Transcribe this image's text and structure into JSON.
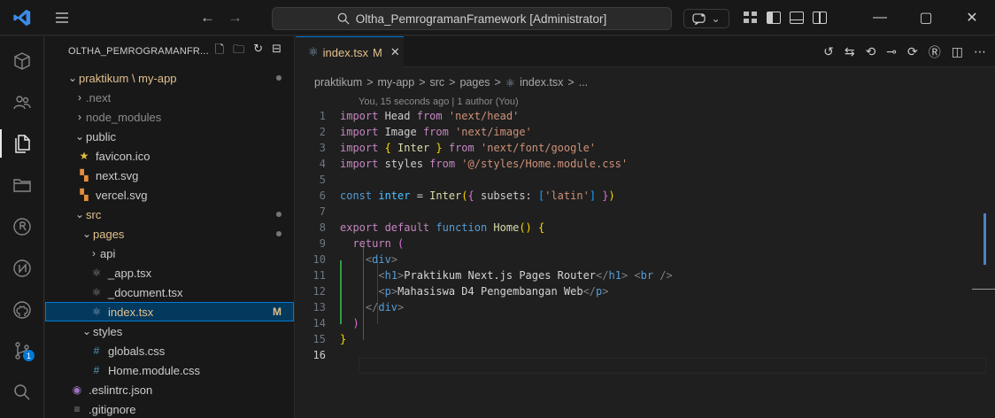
{
  "titlebar": {
    "search_text": "Oltha_PemrogramanFramework [Administrator]",
    "back": "←",
    "forward": "→",
    "copilot_caret": "⌄",
    "minimize": "—",
    "maximize": "▢",
    "close": "✕"
  },
  "explorer": {
    "header": "OLTHA_PEMROGRAMANFR...",
    "root": "praktikum \\ my-app",
    "items": {
      "next": ".next",
      "node_modules": "node_modules",
      "public": "public",
      "favicon": "favicon.ico",
      "next_svg": "next.svg",
      "vercel_svg": "vercel.svg",
      "src": "src",
      "pages": "pages",
      "api": "api",
      "app": "_app.tsx",
      "document": "_document.tsx",
      "index": "index.tsx",
      "index_status": "M",
      "styles": "styles",
      "globals": "globals.css",
      "home_module": "Home.module.css",
      "eslintrc": ".eslintrc.json",
      "gitignore": ".gitignore"
    }
  },
  "tab": {
    "name": "index.tsx",
    "status": "M",
    "close": "✕"
  },
  "breadcrumb": {
    "parts": [
      "praktikum",
      "my-app",
      "src",
      "pages",
      "index.tsx",
      "..."
    ],
    "sep": ">"
  },
  "blame": "You, 15 seconds ago | 1 author (You)",
  "code": {
    "line_numbers": [
      "1",
      "2",
      "3",
      "4",
      "5",
      "6",
      "7",
      "8",
      "9",
      "10",
      "11",
      "12",
      "13",
      "14",
      "15",
      "16"
    ],
    "l1": [
      "import",
      " Head ",
      "from",
      " 'next/head'"
    ],
    "l2": [
      "import",
      " Image ",
      "from",
      " 'next/image'"
    ],
    "l3": [
      "import",
      " { ",
      "Inter",
      " } ",
      "from",
      " 'next/font/google'"
    ],
    "l4": [
      "import",
      " styles ",
      "from",
      " '@/styles/Home.module.css'"
    ],
    "l6": [
      "const",
      " inter ",
      "= ",
      "Inter",
      "(",
      "{ ",
      "subsets: ",
      "[",
      "'latin'",
      "]",
      " }",
      ")"
    ],
    "l8": [
      "export",
      " default ",
      "function",
      " Home",
      "()",
      " {"
    ],
    "l9": [
      "return",
      " ("
    ],
    "l10": [
      "<",
      "div",
      ">"
    ],
    "l11": [
      "<",
      "h1",
      ">",
      "Praktikum Next.js Pages Router",
      "</",
      "h1",
      ">",
      " <",
      "br",
      " />"
    ],
    "l12": [
      "<",
      "p",
      ">",
      "Mahasiswa D4 Pengembangan Web",
      "</",
      "p",
      ">"
    ],
    "l13": [
      "</",
      "div",
      ">"
    ],
    "l14": [
      ")"
    ],
    "l15": [
      "}"
    ]
  },
  "colors": {
    "accent": "#0078d4",
    "keyword": "#c586c0",
    "string": "#ce9178",
    "function": "#dcdcaa",
    "tag": "#569cd6"
  }
}
